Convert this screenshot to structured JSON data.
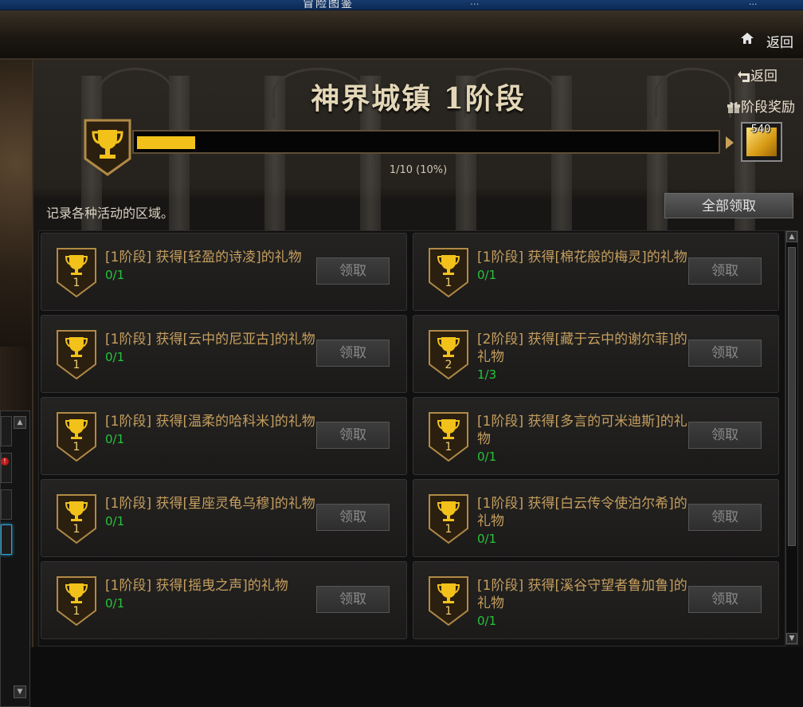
{
  "window": {
    "title": "冒险图鉴",
    "right_text": "...",
    "right_icons": "..."
  },
  "header": {
    "back_label": "返回"
  },
  "panel": {
    "title": "神界城镇 1阶段",
    "return_label": "返回",
    "stage_reward_label": "阶段奖励",
    "progress_text": "1/10 (10%)",
    "progress": 0.1,
    "reward_count": "540",
    "description": "记录各种活动的区域。",
    "claim_all_label": "全部领取"
  },
  "achievements": [
    {
      "level": "1",
      "text": "[1阶段] 获得[轻盈的诗凌]的礼物",
      "progress": "0/1",
      "button": "领取"
    },
    {
      "level": "1",
      "text": "[1阶段] 获得[棉花般的梅灵]的礼物",
      "progress": "0/1",
      "button": "领取"
    },
    {
      "level": "1",
      "text": "[1阶段] 获得[云中的尼亚古]的礼物",
      "progress": "0/1",
      "button": "领取"
    },
    {
      "level": "2",
      "text": "[2阶段] 获得[藏于云中的谢尔菲]的礼物",
      "progress": "1/3",
      "button": "领取"
    },
    {
      "level": "1",
      "text": "[1阶段] 获得[温柔的哈科米]的礼物",
      "progress": "0/1",
      "button": "领取"
    },
    {
      "level": "1",
      "text": "[1阶段] 获得[多言的可米迪斯]的礼物",
      "progress": "0/1",
      "button": "领取"
    },
    {
      "level": "1",
      "text": "[1阶段] 获得[星座灵龟乌穆]的礼物",
      "progress": "0/1",
      "button": "领取"
    },
    {
      "level": "1",
      "text": "[1阶段] 获得[白云传令使泊尔希]的礼物",
      "progress": "0/1",
      "button": "领取"
    },
    {
      "level": "1",
      "text": "[1阶段] 获得[摇曳之声]的礼物",
      "progress": "0/1",
      "button": "领取"
    },
    {
      "level": "1",
      "text": "[1阶段] 获得[溪谷守望者鲁加鲁]的礼物",
      "progress": "0/1",
      "button": "领取"
    }
  ],
  "colors": {
    "accent": "#f2c21b",
    "progress_green": "#27c43a",
    "text_gold": "#c59e5e"
  }
}
